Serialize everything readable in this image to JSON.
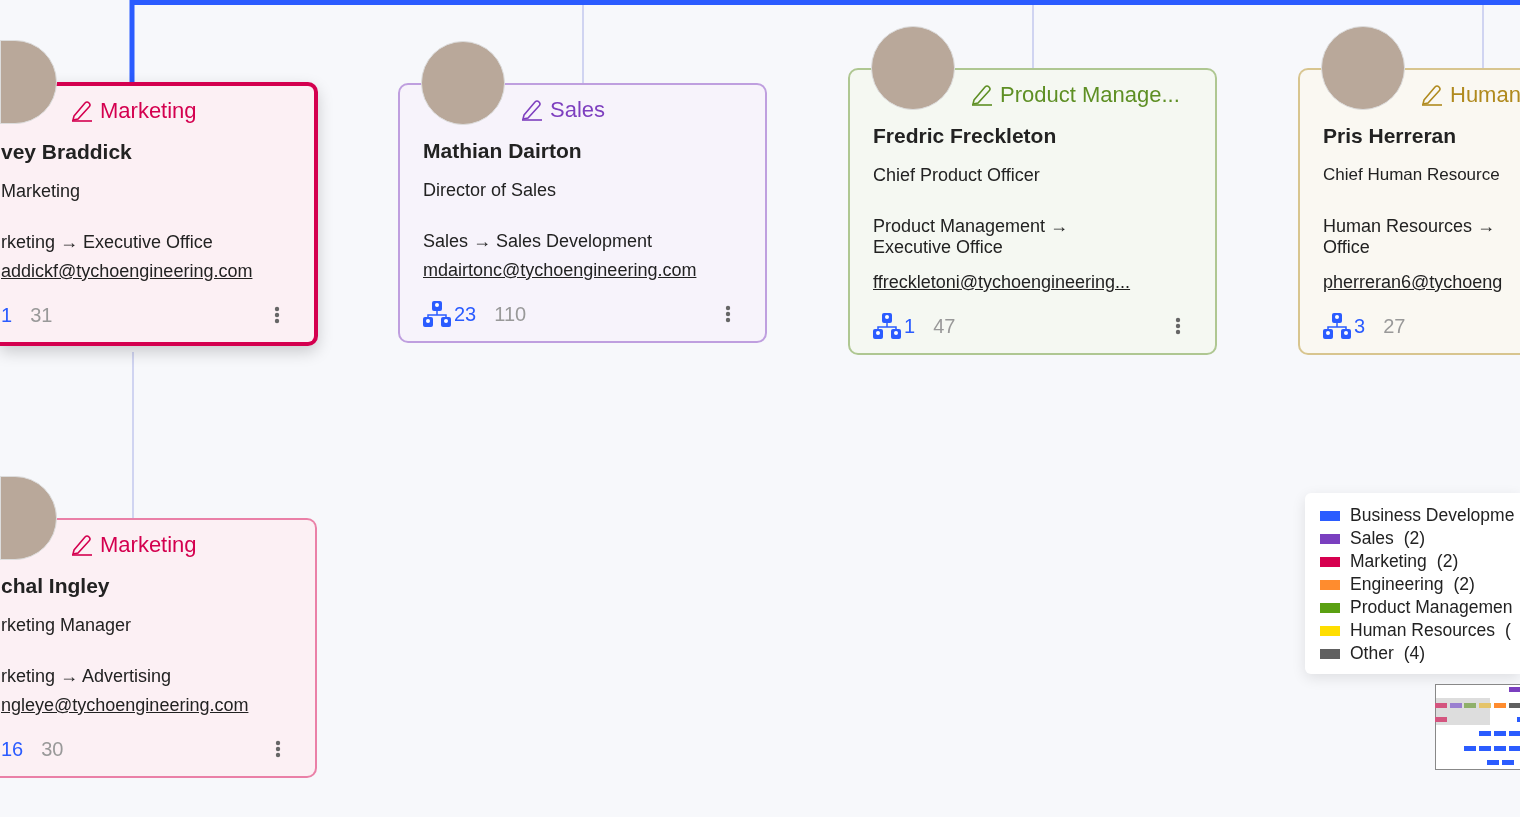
{
  "cards": [
    {
      "department": "Marketing",
      "color": "#d4004f",
      "selected": true,
      "name": "vey Braddick",
      "title": "Marketing",
      "path_lines": [
        "rketing → Executive Office"
      ],
      "email": "addickf@tychoengineering.com",
      "reports_icon": false,
      "reports": "1",
      "count": "31"
    },
    {
      "department": "Sales",
      "color": "#7e3fbf",
      "selected": false,
      "name": "Mathian Dairton",
      "title": "Director of Sales",
      "path_lines": [
        "Sales → Sales Development"
      ],
      "email": "mdairtonc@tychoengineering.com",
      "reports_icon": true,
      "reports": "23",
      "count": "110"
    },
    {
      "department": "Product Manage...",
      "color": "#5e8f24",
      "selected": false,
      "name": "Fredric Freckleton",
      "title": "Chief Product Officer",
      "path_lines": [
        "Product Management →",
        "Executive Office"
      ],
      "email": "ffreckletoni@tychoengineering...",
      "reports_icon": true,
      "reports": "1",
      "count": "47"
    },
    {
      "department": "Human",
      "color": "#b08a1e",
      "selected": false,
      "name": "Pris Herreran",
      "title": "Chief Human Resource",
      "path_lines": [
        "Human Resources →",
        "Office"
      ],
      "email": "pherreran6@tychoeng",
      "reports_icon": true,
      "reports": "3",
      "count": "27"
    },
    {
      "department": "Marketing",
      "color": "#d4004f",
      "selected": false,
      "name": "chal Ingley",
      "title": "rketing Manager",
      "path_lines": [
        "rketing → Advertising"
      ],
      "email": "ngleye@tychoengineering.com",
      "reports_icon": false,
      "reports": "16",
      "count": "30"
    }
  ],
  "legend": [
    {
      "label": "Business Developme",
      "color": "#2b5cff"
    },
    {
      "label": "Sales",
      "count": "(2)",
      "color": "#7a3fbf"
    },
    {
      "label": "Marketing",
      "count": "(2)",
      "color": "#d6004f"
    },
    {
      "label": "Engineering",
      "count": "(2)",
      "color": "#ff8c2e"
    },
    {
      "label": "Product Managemen",
      "color": "#5aa012"
    },
    {
      "label": "Human Resources",
      "count": "(",
      "color": "#ffde00"
    },
    {
      "label": "Other",
      "count": "(4)",
      "color": "#606060"
    }
  ]
}
